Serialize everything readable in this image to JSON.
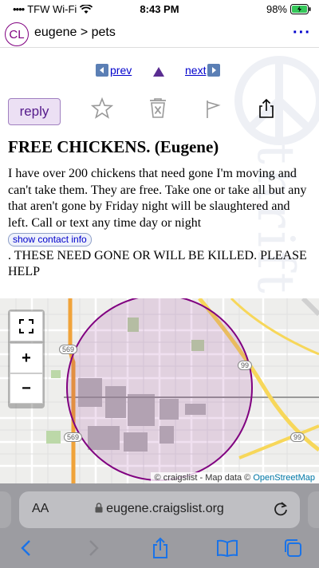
{
  "status_bar": {
    "carrier": "TFW Wi-Fi",
    "time": "8:43 PM",
    "battery": "98%"
  },
  "header": {
    "logo": "CL",
    "breadcrumb": "eugene > pets",
    "menu": "···"
  },
  "nav": {
    "prev": "prev",
    "next": "next"
  },
  "post": {
    "reply": "reply",
    "title": "FREE CHICKENS. (Eugene)",
    "body_1": "I have over 200 chickens that need gone I'm moving and can't take them. They are free. Take one or take all but any that aren't gone by Friday night will be slaughtered and left. Call or text any time day or night",
    "contact": "show contact info",
    "body_2": ". THESE NEED GONE OR WILL BE KILLED. PLEASE HELP",
    "watermark": "thrift"
  },
  "map": {
    "zoom_in": "+",
    "zoom_out": "−",
    "routes": [
      "569",
      "99",
      "569",
      "99"
    ],
    "attribution_prefix": "© craigslist - Map data © ",
    "attribution_link": "OpenStreetMap"
  },
  "browser": {
    "text_size": "AA",
    "url": "eugene.craigslist.org"
  },
  "colors": {
    "accent": "#800080",
    "link": "#0000cc",
    "circle": "#800080"
  },
  "icons": [
    "wifi-icon",
    "battery-icon",
    "star-icon",
    "hide-icon",
    "flag-icon",
    "share-icon",
    "fullscreen-icon",
    "lock-icon",
    "reload-icon",
    "back-icon",
    "forward-icon",
    "bookmarks-icon",
    "tabs-icon"
  ]
}
